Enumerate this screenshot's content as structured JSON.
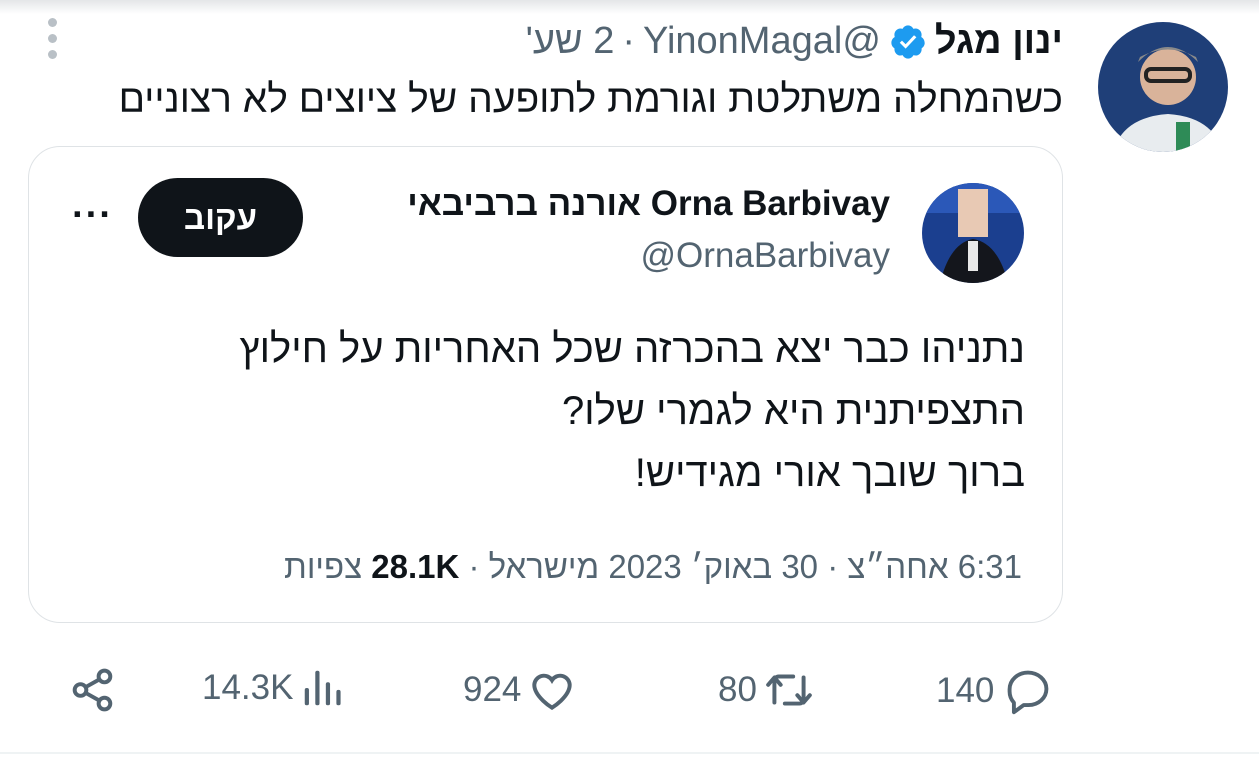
{
  "post": {
    "author_name": "ינון מגל",
    "handle": "@YinonMagal",
    "separator": "·",
    "time": "2 שע'",
    "text": "כשהמחלה משתלטת וגורמת לתופעה של ציוצים לא רצוניים"
  },
  "quoted": {
    "name": "Orna Barbivay אורנה ברביבאי",
    "handle": "@OrnaBarbivay",
    "follow_label": "עקוב",
    "more_label": "···",
    "lines": [
      "נתניהו כבר יצא בהכרזה שכל האחריות על חילוץ",
      "התצפיתנית היא לגמרי שלו?",
      "ברוך שובך אורי מגידיש!"
    ],
    "meta_prefix": "6:31 אחה״צ · 30 באוק׳ 2023 מישראל · ",
    "views_count": "28.1K",
    "views_label": " צפיות"
  },
  "actions": {
    "replies": "140",
    "retweets": "80",
    "likes": "924",
    "views": "14.3K"
  },
  "colors": {
    "text": "#0f1419",
    "secondary": "#536471",
    "verified": "#1d9bf0",
    "border": "#dfe3e6"
  },
  "icons": [
    "verified-icon",
    "kebab-icon",
    "reply-icon",
    "retweet-icon",
    "like-icon",
    "views-icon",
    "share-icon"
  ]
}
